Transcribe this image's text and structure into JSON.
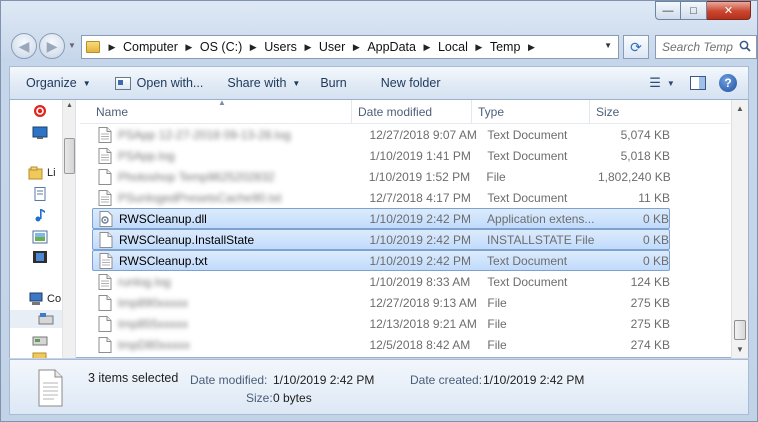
{
  "window": {
    "minimize_glyph": "—",
    "maximize_glyph": "□",
    "close_glyph": "✕"
  },
  "address_bar": {
    "crumbs": [
      "Computer",
      "OS (C:)",
      "Users",
      "User",
      "AppData",
      "Local",
      "Temp"
    ],
    "separator_glyph": "▶"
  },
  "search": {
    "placeholder": "Search Temp"
  },
  "toolbar": {
    "organize_label": "Organize",
    "open_with_label": "Open with...",
    "share_with_label": "Share with",
    "burn_label": "Burn",
    "new_folder_label": "New folder"
  },
  "nav_pane": {
    "libraries_label": "Li",
    "computer_label": "Co"
  },
  "columns": {
    "name": "Name",
    "date_modified": "Date modified",
    "type": "Type",
    "size": "Size"
  },
  "files": [
    {
      "name": "PSApp 12-27-2018 09-13-28.log",
      "date": "12/27/2018 9:07 AM",
      "type": "Text Document",
      "size": "5,074 KB",
      "blurred": true,
      "selected": false,
      "icon": "text-file-icon"
    },
    {
      "name": "PSApp.log",
      "date": "1/10/2019 1:41 PM",
      "type": "Text Document",
      "size": "5,018 KB",
      "blurred": true,
      "selected": false,
      "icon": "text-file-icon"
    },
    {
      "name": "Photoshop Temp9625202832",
      "date": "1/10/2019 1:52 PM",
      "type": "File",
      "size": "1,802,240 KB",
      "blurred": true,
      "selected": false,
      "icon": "blank-file-icon"
    },
    {
      "name": "PSunlogedPresetsCache90.txt",
      "date": "12/7/2018 4:17 PM",
      "type": "Text Document",
      "size": "11 KB",
      "blurred": true,
      "selected": false,
      "icon": "text-file-icon"
    },
    {
      "name": "RWSCleanup.dll",
      "date": "1/10/2019 2:42 PM",
      "type": "Application extens...",
      "size": "0 KB",
      "blurred": false,
      "selected": true,
      "icon": "dll-file-icon"
    },
    {
      "name": "RWSCleanup.InstallState",
      "date": "1/10/2019 2:42 PM",
      "type": "INSTALLSTATE File",
      "size": "0 KB",
      "blurred": false,
      "selected": true,
      "icon": "blank-file-icon"
    },
    {
      "name": "RWSCleanup.txt",
      "date": "1/10/2019 2:42 PM",
      "type": "Text Document",
      "size": "0 KB",
      "blurred": false,
      "selected": true,
      "icon": "text-file-icon"
    },
    {
      "name": "runlog.log",
      "date": "1/10/2019 8:33 AM",
      "type": "Text Document",
      "size": "124 KB",
      "blurred": true,
      "selected": false,
      "icon": "text-file-icon"
    },
    {
      "name": "tmp890xxxxx",
      "date": "12/27/2018 9:13 AM",
      "type": "File",
      "size": "275 KB",
      "blurred": true,
      "selected": false,
      "icon": "blank-file-icon"
    },
    {
      "name": "tmp855xxxxx",
      "date": "12/13/2018 9:21 AM",
      "type": "File",
      "size": "275 KB",
      "blurred": true,
      "selected": false,
      "icon": "blank-file-icon"
    },
    {
      "name": "tmpD80xxxxx",
      "date": "12/5/2018 8:42 AM",
      "type": "File",
      "size": "274 KB",
      "blurred": true,
      "selected": false,
      "icon": "blank-file-icon"
    }
  ],
  "details": {
    "selection_count": "3 items selected",
    "date_modified_label": "Date modified:",
    "date_modified_value": "1/10/2019 2:42 PM",
    "date_created_label": "Date created:",
    "date_created_value": "1/10/2019 2:42 PM",
    "size_label": "Size:",
    "size_value": "0 bytes"
  }
}
